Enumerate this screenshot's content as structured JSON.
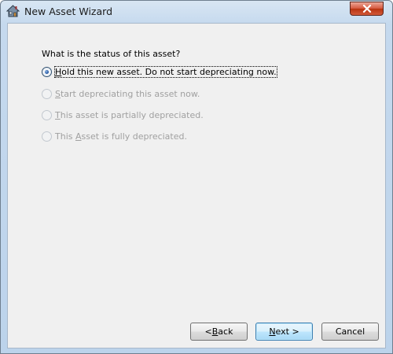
{
  "window": {
    "title": "New Asset Wizard",
    "close_label": "×"
  },
  "content": {
    "question": "What is the status of this asset?",
    "options": [
      {
        "pre": "",
        "accel": "H",
        "post": "old this new asset. Do not start depreciating now.",
        "selected": true,
        "enabled": true
      },
      {
        "pre": "",
        "accel": "S",
        "post": "tart depreciating this asset now.",
        "selected": false,
        "enabled": false
      },
      {
        "pre": "",
        "accel": "T",
        "post": "his asset is partially depreciated.",
        "selected": false,
        "enabled": false
      },
      {
        "pre": "This ",
        "accel": "A",
        "post": "sset is fully depreciated.",
        "selected": false,
        "enabled": false
      }
    ]
  },
  "buttons": {
    "back": {
      "pre": "< ",
      "accel": "B",
      "post": "ack"
    },
    "next": {
      "pre": "",
      "accel": "N",
      "post": "ext >"
    },
    "cancel": {
      "label": "Cancel"
    }
  },
  "colors": {
    "accent": "#3c7fb1",
    "close_red": "#c8462b",
    "disabled_text": "#a0a0a0"
  },
  "icons": {
    "app": "house-asset-icon",
    "close": "close-icon"
  }
}
